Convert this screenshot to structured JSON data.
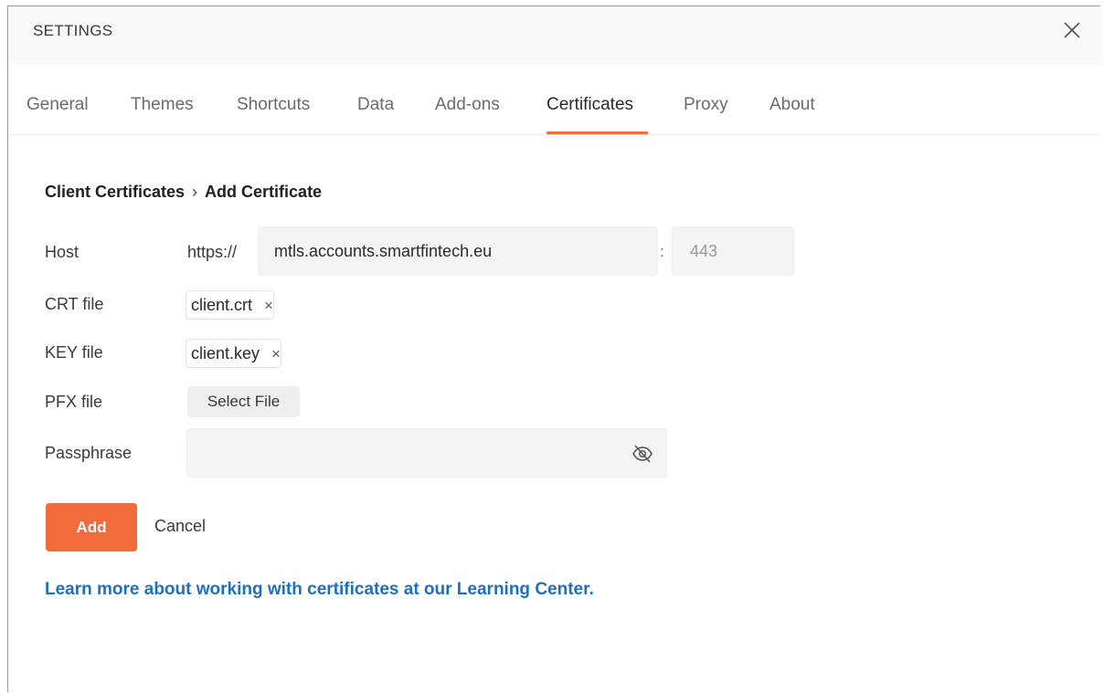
{
  "header": {
    "title": "SETTINGS",
    "close_icon": "close-icon"
  },
  "tabs": [
    {
      "label": "General"
    },
    {
      "label": "Themes"
    },
    {
      "label": "Shortcuts"
    },
    {
      "label": "Data"
    },
    {
      "label": "Add-ons"
    },
    {
      "label": "Certificates",
      "active": true
    },
    {
      "label": "Proxy"
    },
    {
      "label": "About"
    }
  ],
  "breadcrumb": {
    "parent": "Client Certificates",
    "separator": "›",
    "current": "Add Certificate"
  },
  "form": {
    "host_label": "Host",
    "host_prefix": "https://",
    "host_value": "mtls.accounts.smartfintech.eu",
    "port_separator": ":",
    "port_placeholder": "443",
    "crt_label": "CRT file",
    "crt_file": "client.crt",
    "key_label": "KEY file",
    "key_file": "client.key",
    "pfx_label": "PFX file",
    "pfx_button": "Select File",
    "passphrase_label": "Passphrase",
    "passphrase_value": "",
    "remove_glyph": "×",
    "visibility_icon": "eye-off-icon"
  },
  "actions": {
    "add_label": "Add",
    "cancel_label": "Cancel"
  },
  "learn_more": "Learn more about working with certificates at our Learning Center.",
  "colors": {
    "accent": "#f26b3a",
    "link": "#1f6fbf"
  }
}
